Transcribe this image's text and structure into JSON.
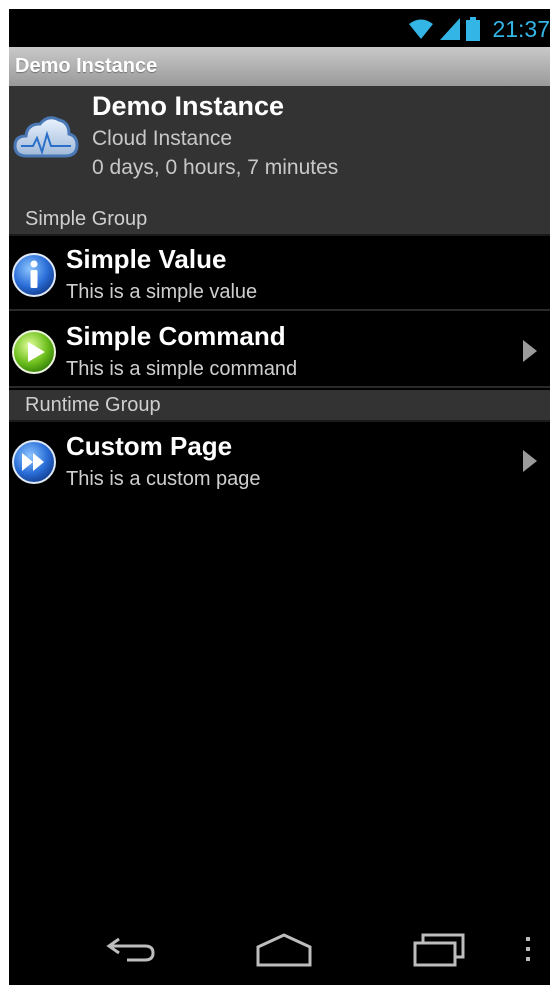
{
  "status_bar": {
    "time": "21:37",
    "icons": [
      "wifi-icon",
      "signal-icon",
      "battery-icon"
    ],
    "accent_color": "#33b5e5"
  },
  "title_bar": {
    "title": "Demo Instance"
  },
  "instance": {
    "icon": "cloud-icon",
    "title": "Demo Instance",
    "subtitle": "Cloud Instance",
    "uptime": "0 days, 0 hours, 7 minutes"
  },
  "groups": [
    {
      "label": "Simple Group",
      "items": [
        {
          "icon": "info-icon",
          "title": "Simple Value",
          "subtitle": "This is a simple value",
          "has_chevron": false
        },
        {
          "icon": "play-icon",
          "title": "Simple Command",
          "subtitle": "This is a simple command",
          "has_chevron": true
        }
      ]
    },
    {
      "label": "Runtime Group",
      "items": [
        {
          "icon": "fast-forward-icon",
          "title": "Custom Page",
          "subtitle": "This is a custom page",
          "has_chevron": true
        }
      ]
    }
  ],
  "nav_bar": {
    "buttons": [
      "back-icon",
      "home-icon",
      "recent-apps-icon",
      "overflow-menu-icon"
    ]
  }
}
